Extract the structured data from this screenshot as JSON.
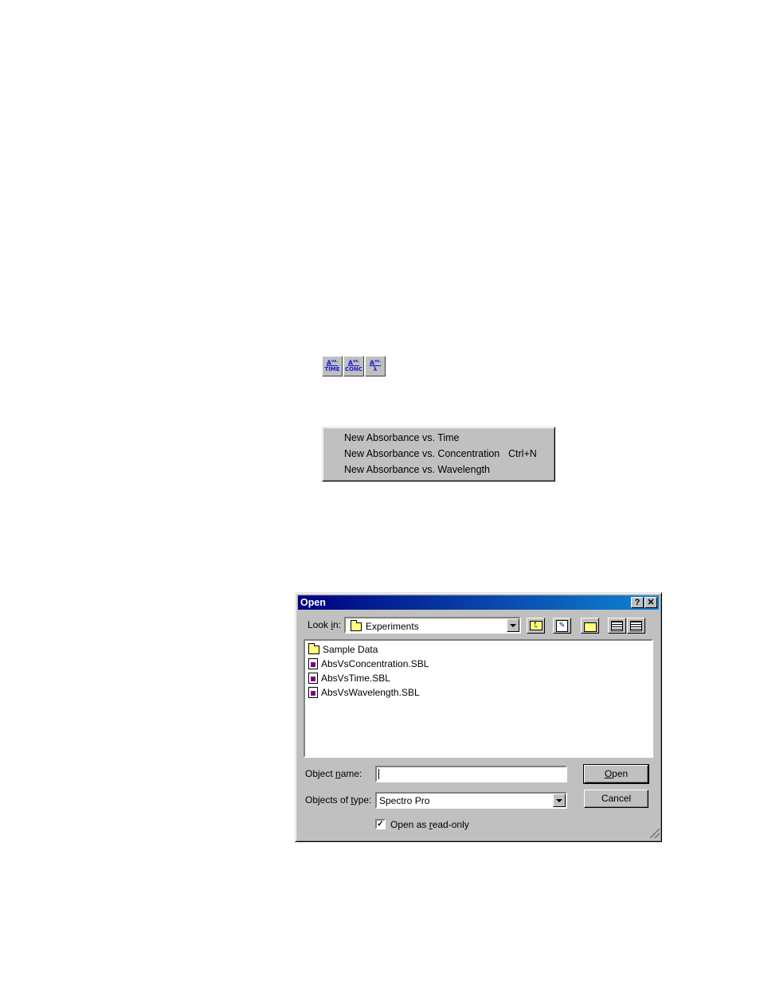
{
  "toolbar": {
    "buttons": [
      {
        "top": "A",
        "sup": "vs.",
        "bottom": "TIME"
      },
      {
        "top": "A",
        "sup": "vs.",
        "bottom": "CONC"
      },
      {
        "top": "A",
        "sup": "vs.",
        "bottom": "λ"
      }
    ]
  },
  "menu": {
    "items": [
      {
        "label": "New Absorbance vs. Time",
        "shortcut": ""
      },
      {
        "label": "New Absorbance vs. Concentration",
        "shortcut": "Ctrl+N"
      },
      {
        "label": "New Absorbance vs. Wavelength",
        "shortcut": ""
      }
    ]
  },
  "dialog": {
    "title": "Open",
    "help_btn": "?",
    "close_btn": "✕",
    "look_in": {
      "prefix": "Look ",
      "accel": "i",
      "suffix": "n:",
      "value": "Experiments"
    },
    "files": [
      {
        "name": "Sample Data",
        "icon": "folder-icon"
      },
      {
        "name": "AbsVsConcentration.SBL",
        "icon": "document-icon"
      },
      {
        "name": "AbsVsTime.SBL",
        "icon": "document-icon"
      },
      {
        "name": "AbsVsWavelength.SBL",
        "icon": "document-icon"
      }
    ],
    "object_name": {
      "prefix": "Object ",
      "accel": "n",
      "suffix": "ame:",
      "value": ""
    },
    "object_type": {
      "prefix": "Objects of ",
      "accel": "t",
      "suffix": "ype:",
      "value": "Spectro Pro"
    },
    "open_button": {
      "accel": "O",
      "rest": "pen"
    },
    "cancel_button": "Cancel",
    "readonly": {
      "prefix": "Open as ",
      "accel": "r",
      "suffix": "ead-only",
      "checked": "✓"
    }
  }
}
